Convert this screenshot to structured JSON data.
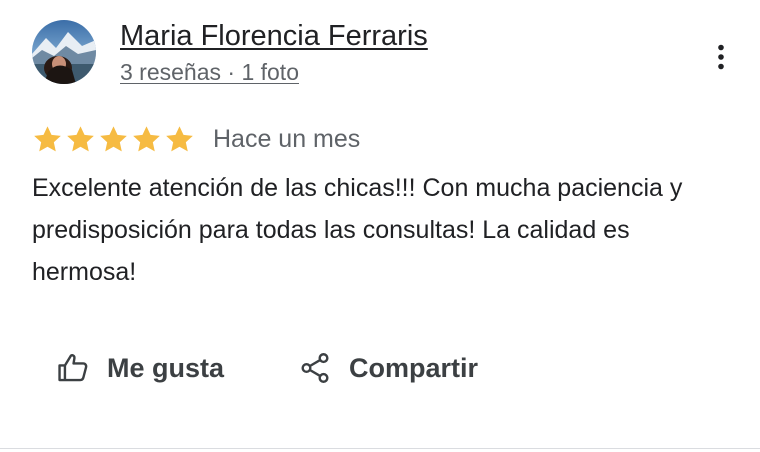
{
  "review": {
    "author": {
      "name": "Maria Florencia Ferraris",
      "meta": "3 reseñas · 1 foto",
      "avatar_icon": "profile-photo"
    },
    "rating": {
      "stars": 5,
      "max": 5,
      "star_color": "#f6bb42"
    },
    "date": "Hace un mes",
    "text": "Excelente atención de las chicas!!! Con mucha paciencia y predisposición para todas las consultas! La calidad es hermosa!",
    "more_icon": "more-vert-icon"
  },
  "actions": {
    "like_label": "Me gusta",
    "like_icon": "thumb-up-icon",
    "share_label": "Compartir",
    "share_icon": "share-icon"
  },
  "colors": {
    "text_primary": "#202124",
    "text_secondary": "#5f6368",
    "divider": "#dadce0"
  }
}
